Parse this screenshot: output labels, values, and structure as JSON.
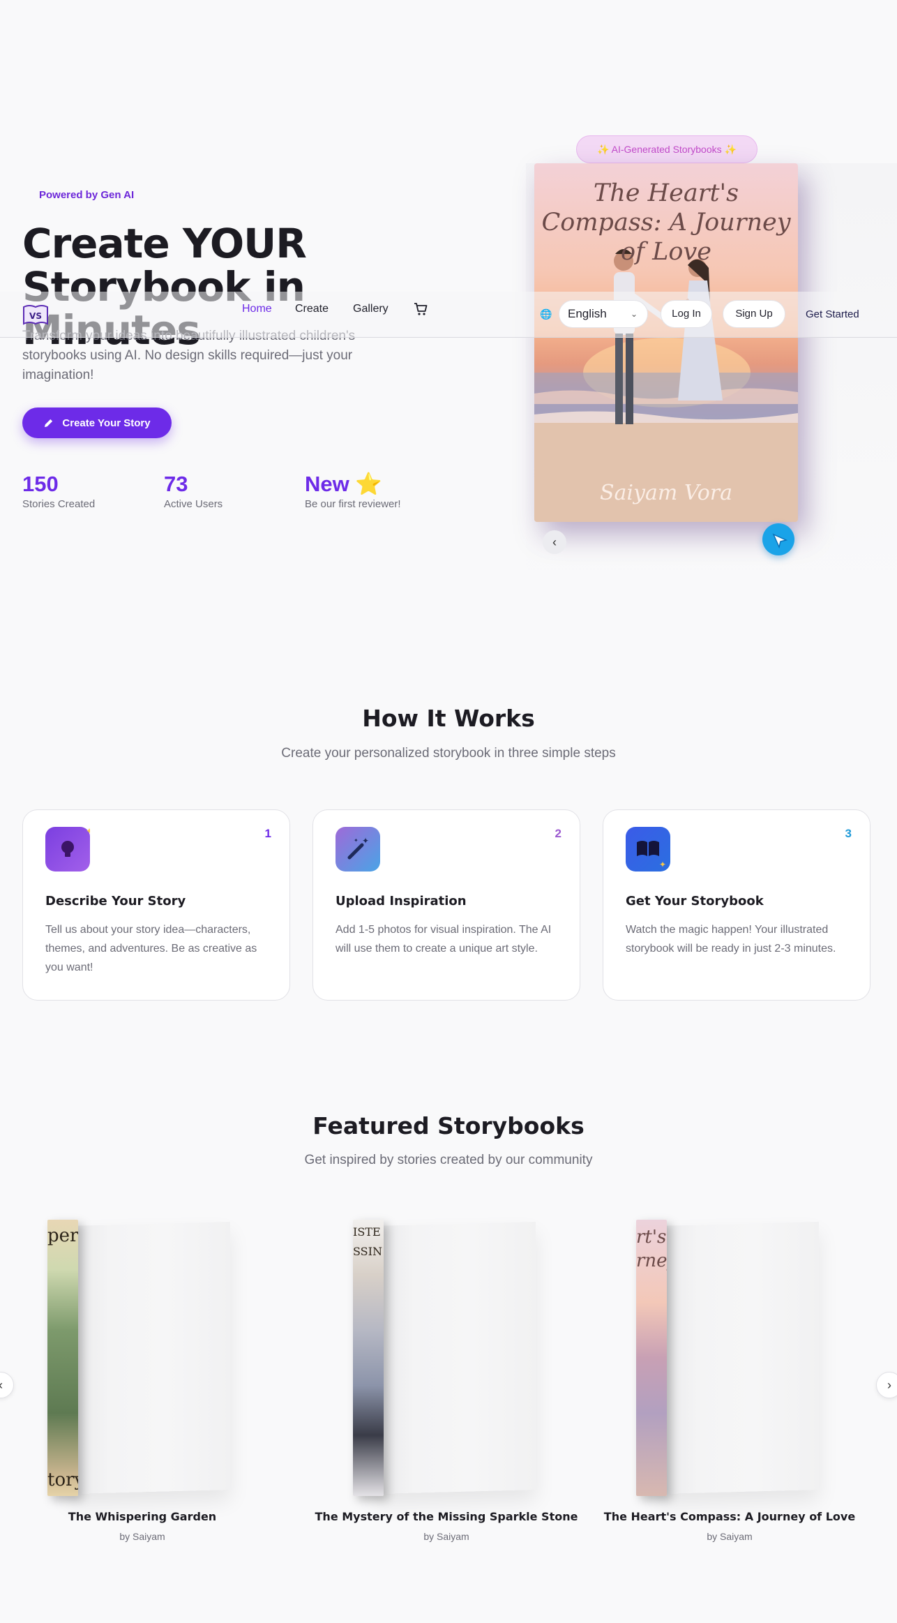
{
  "hero": {
    "badge": "Powered by Gen AI",
    "title": "Create YOUR Storybook in Minutes",
    "description": "Transform your ideas into beautifully illustrated children's storybooks using AI. No design skills required—just your imagination!",
    "cta": "Create Your Story",
    "stats": [
      {
        "value": "150",
        "label": "Stories Created"
      },
      {
        "value": "73",
        "label": "Active Users"
      },
      {
        "value": "New ⭐",
        "label": "Be our first reviewer!"
      }
    ]
  },
  "preview": {
    "badge": "✨  AI-Generated Storybooks  ✨",
    "cover_title": "The Heart's Compass: A Journey of Love",
    "cover_author": "Saiyam Vora",
    "prev_arrow": "‹"
  },
  "nav": {
    "logo_text": "VS",
    "links": [
      "Home",
      "Create",
      "Gallery"
    ],
    "active": "Home",
    "language": "English",
    "login": "Log In",
    "signup": "Sign Up",
    "get_started": "Get Started"
  },
  "how_it_works": {
    "title": "How It Works",
    "subtitle": "Create your personalized storybook in three simple steps",
    "steps": [
      {
        "num": "1",
        "title": "Describe Your Story",
        "text": "Tell us about your story idea—characters, themes, and adventures. Be as creative as you want!",
        "icon": "lightbulb-icon",
        "num_color": "#6d2be8"
      },
      {
        "num": "2",
        "title": "Upload Inspiration",
        "text": "Add 1-5 photos for visual inspiration. The AI will use them to create a unique art style.",
        "icon": "magic-wand-icon",
        "num_color": "#9b59d0"
      },
      {
        "num": "3",
        "title": "Get Your Storybook",
        "text": "Watch the magic happen! Your illustrated storybook will be ready in just 2-3 minutes.",
        "icon": "open-book-icon",
        "num_color": "#1f9ad8"
      }
    ]
  },
  "featured": {
    "title": "Featured Storybooks",
    "subtitle": "Get inspired by stories created by our community",
    "books": [
      {
        "title": "The Whispering Garden",
        "author": "by Saiyam",
        "spine_top": "per",
        "spine_bottom": "tory"
      },
      {
        "title": "The Mystery of the Missing Sparkle Stone",
        "author": "by Saiyam",
        "spine_top": "ISTE",
        "spine_bottom": "SSIN"
      },
      {
        "title": "The Heart's Compass: A Journey of Love",
        "author": "by Saiyam",
        "spine_top": "rt's",
        "spine_bottom": "rney"
      }
    ],
    "prev": "‹",
    "next": "›"
  }
}
